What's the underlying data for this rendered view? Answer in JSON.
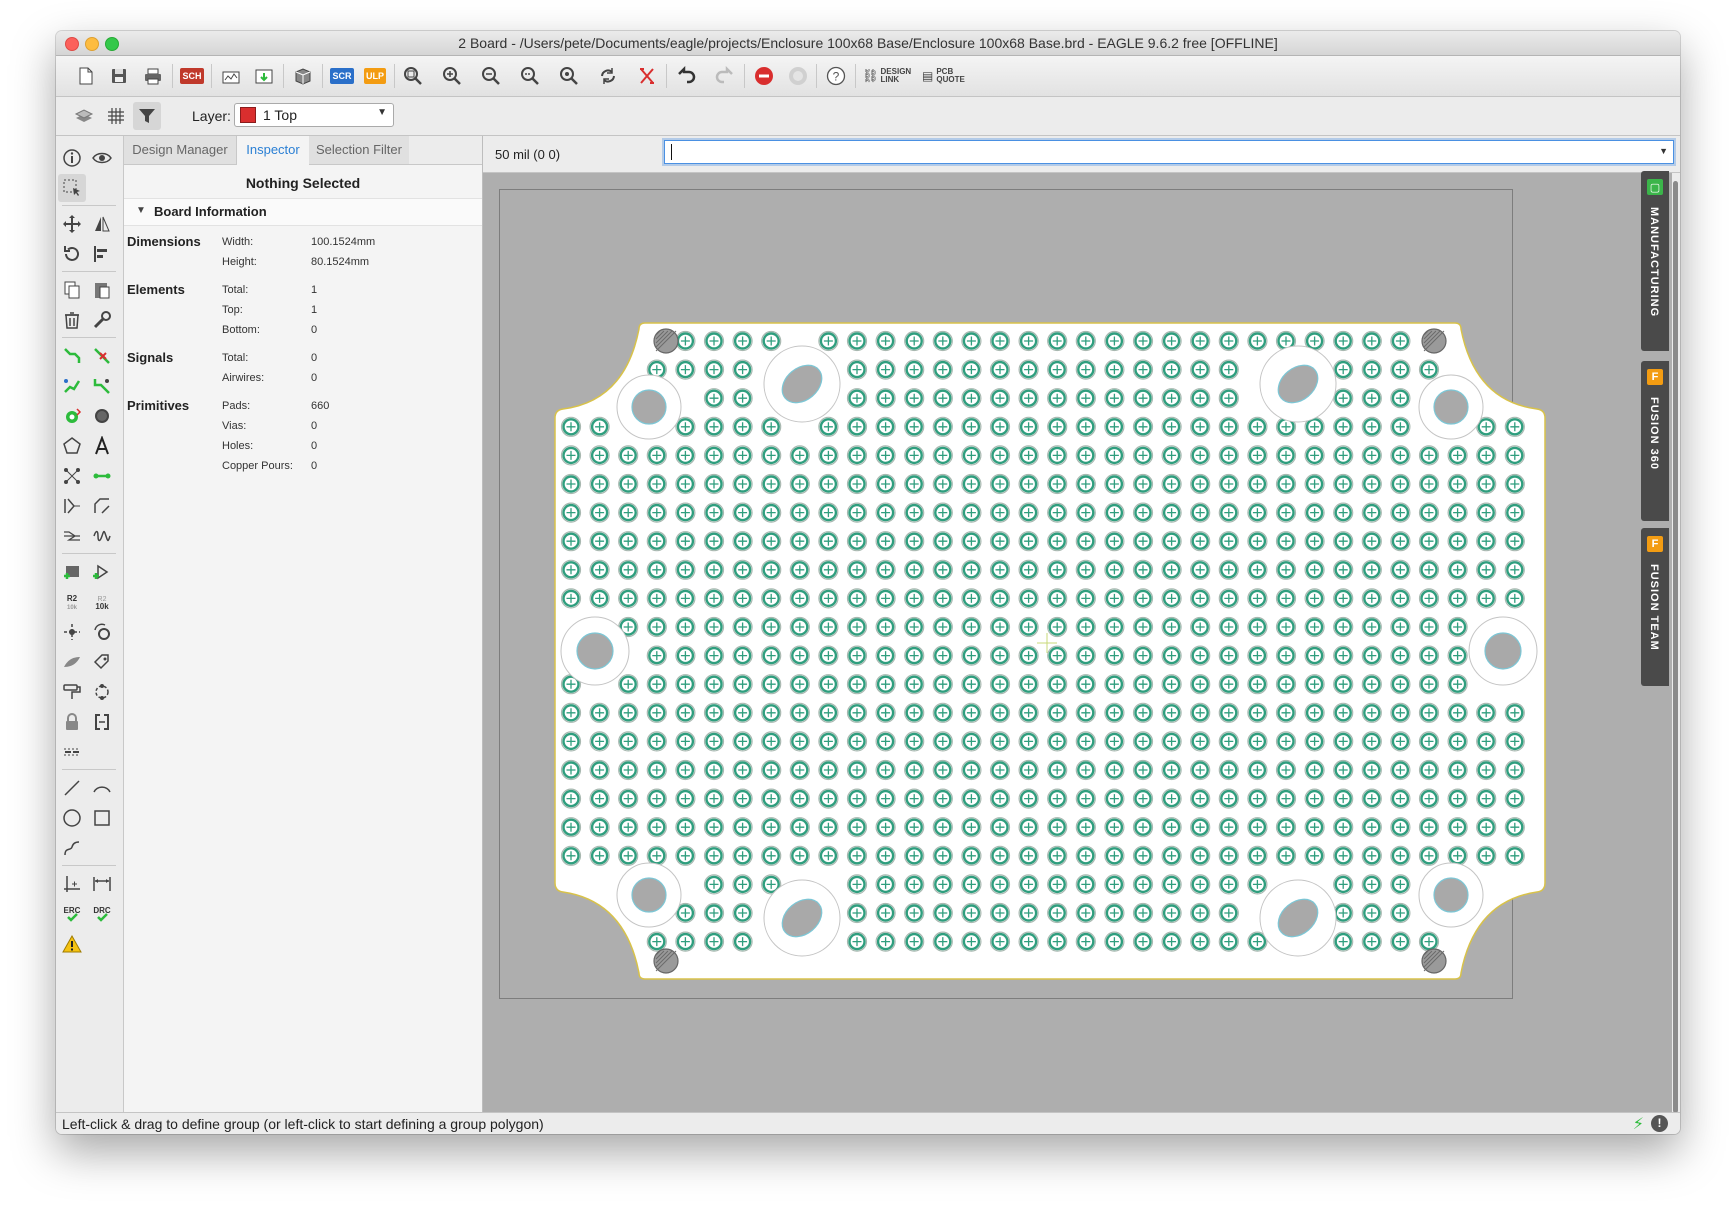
{
  "window": {
    "title": "2 Board - /Users/pete/Documents/eagle/projects/Enclosure 100x68 Base/Enclosure 100x68 Base.brd - EAGLE 9.6.2 free [OFFLINE]"
  },
  "toolbar": {
    "icons": [
      "new-icon",
      "save-icon",
      "print-icon",
      "sch-brd-switch-icon",
      "cam-icon",
      "export-icon",
      "3d-package-icon",
      "script-icon",
      "ulp-icon",
      "zoom-fit-icon",
      "zoom-in-icon",
      "zoom-out-icon",
      "zoom-select-icon",
      "zoom-last-icon",
      "redraw-icon",
      "ratsnest-icon",
      "undo-icon",
      "redo-icon",
      "stop-icon",
      "go-icon",
      "help-icon",
      "design-link-icon",
      "pcb-quote-icon"
    ],
    "sch_badge": "SCH",
    "scr_badge": "SCR",
    "ulp_badge": "ULP",
    "design_link_line1": "DESIGN",
    "design_link_line2": "LINK",
    "pcb_quote_line1": "PCB",
    "pcb_quote_line2": "QUOTE"
  },
  "layerbar": {
    "label": "Layer:",
    "selected_layer": "1 Top",
    "layer_color": "#d92e2e"
  },
  "panel": {
    "tabs": [
      "Design Manager",
      "Inspector",
      "Selection Filter"
    ],
    "active_tab": "Inspector",
    "selection_status": "Nothing Selected",
    "section_title": "Board Information",
    "dimensions": {
      "label": "Dimensions",
      "width_key": "Width:",
      "width": "100.1524mm",
      "height_key": "Height:",
      "height": "80.1524mm"
    },
    "elements": {
      "label": "Elements",
      "total_key": "Total:",
      "total": "1",
      "top_key": "Top:",
      "top": "1",
      "bottom_key": "Bottom:",
      "bottom": "0"
    },
    "signals": {
      "label": "Signals",
      "total_key": "Total:",
      "total": "0",
      "airwires_key": "Airwires:",
      "airwires": "0"
    },
    "primitives": {
      "label": "Primitives",
      "pads_key": "Pads:",
      "pads": "660",
      "vias_key": "Vias:",
      "vias": "0",
      "holes_key": "Holes:",
      "holes": "0",
      "pours_key": "Copper Pours:",
      "pours": "0"
    }
  },
  "command": {
    "grid_readout": "50 mil (0 0)",
    "input_value": ""
  },
  "board": {
    "pad_rows": 22,
    "pad_cols": 34,
    "pad_color": "#2f9e7e",
    "outline_color": "#d8c24a"
  },
  "side_tabs": [
    {
      "label": "MANUFACTURING",
      "icon_color": "#3bb54a"
    },
    {
      "label": "FUSION 360",
      "icon_color": "#f39c12"
    },
    {
      "label": "FUSION TEAM",
      "icon_color": "#f39c12"
    }
  ],
  "status": {
    "message": "Left-click & drag to define group (or left-click to start defining a group polygon)"
  }
}
